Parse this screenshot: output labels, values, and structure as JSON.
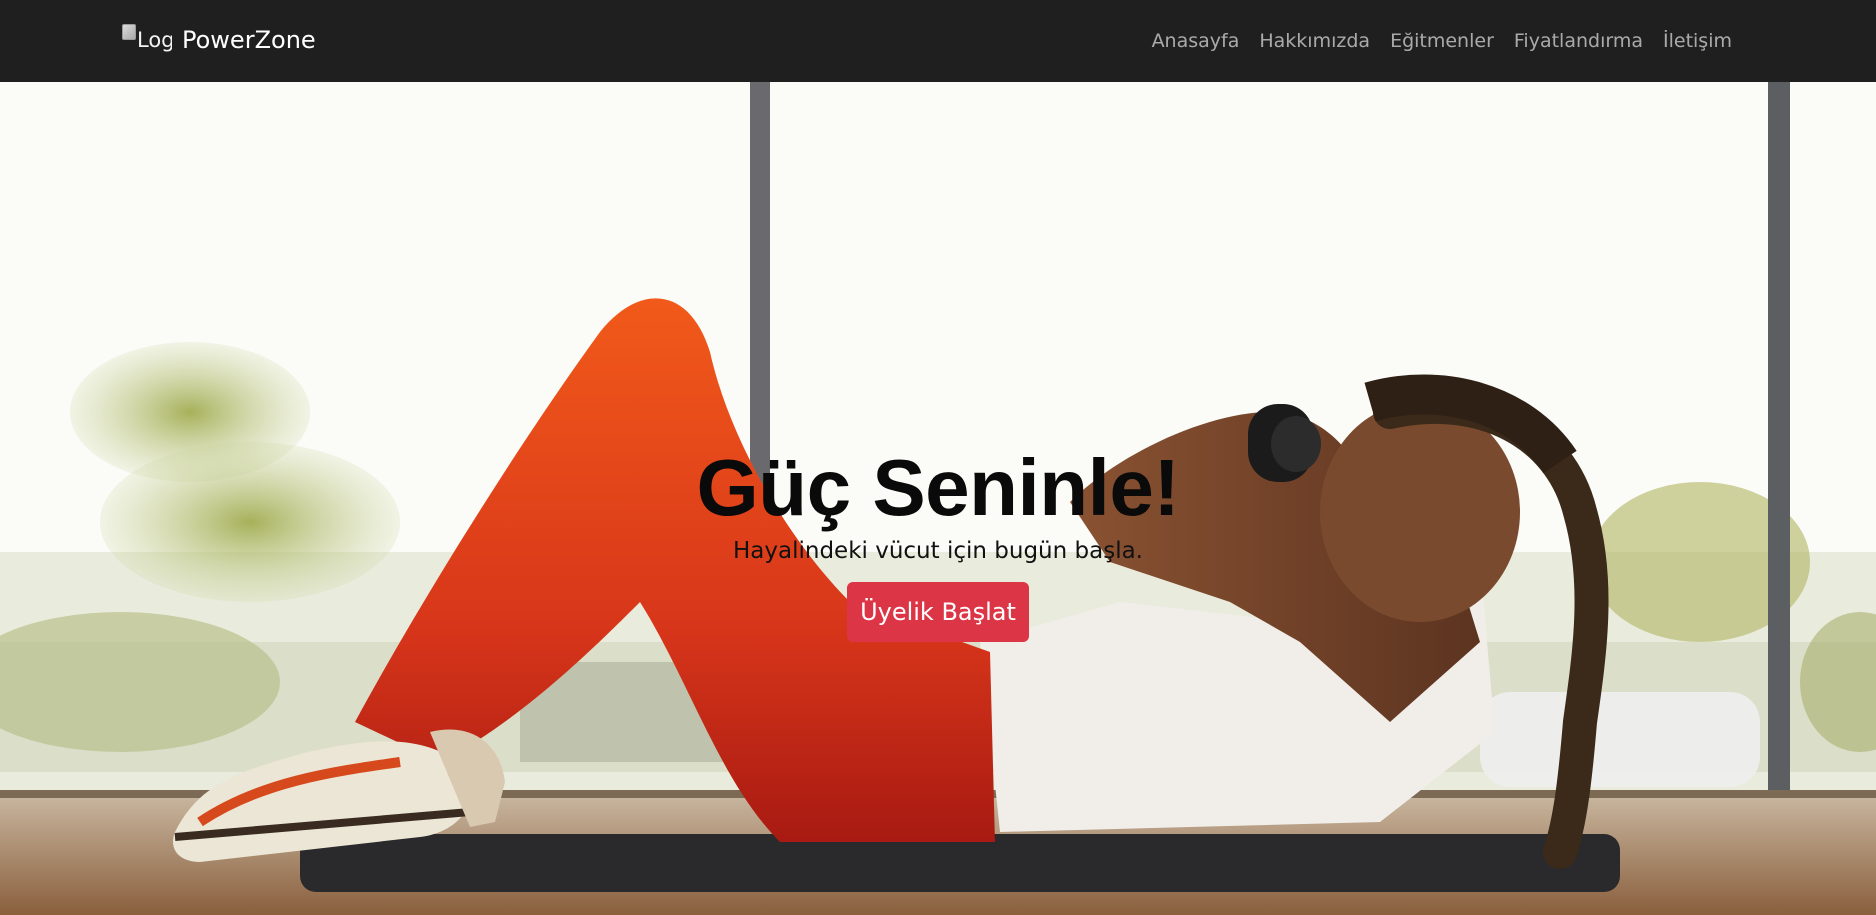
{
  "navbar": {
    "logo_alt": "Logo",
    "brand": "PowerZone",
    "links": [
      "Anasayfa",
      "Hakkımızda",
      "Eğitmenler",
      "Fiyatlandırma",
      "İletişim"
    ]
  },
  "hero": {
    "title": "Güç Seninle!",
    "subtitle": "Hayalindeki vücut için bugün başla.",
    "cta_label": "Üyelik Başlat"
  },
  "colors": {
    "navbar_bg": "#1f1f1f",
    "cta_bg": "#dc3545"
  }
}
